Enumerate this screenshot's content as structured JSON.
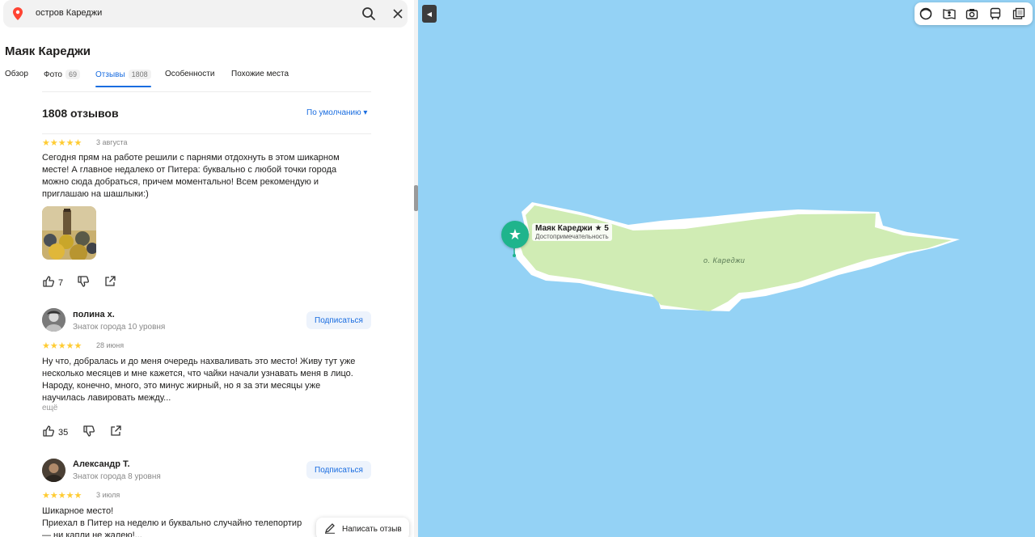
{
  "search": {
    "query": "остров Кареджи"
  },
  "place": {
    "title": "Маяк Кареджи"
  },
  "tabs": [
    {
      "label": "Обзор"
    },
    {
      "label": "Фото",
      "count": "69"
    },
    {
      "label": "Отзывы",
      "count": "1808"
    },
    {
      "label": "Особенности"
    },
    {
      "label": "Похожие места"
    }
  ],
  "reviews_header": {
    "title": "1808 отзывов",
    "sort_label": "По умолчанию ▾"
  },
  "reviews": [
    {
      "stars": "★★★★★",
      "rating": 5,
      "date": "3 августа",
      "text": [
        "Сегодня прям на работе решили с парнями отдохнуть в этом шикарном",
        "месте! А главное недалеко от Питера: буквально с любой точки города",
        "можно сюда добраться, причем моментально! Всем рекомендую и",
        "приглашаю на шашлыки:)"
      ],
      "likes": "7"
    },
    {
      "author": "полина х.",
      "level": "Знаток города 10 уровня",
      "subscribe": "Подписаться",
      "stars": "★★★★★",
      "rating": 5,
      "date": "28 июня",
      "text": [
        "Ну что, добралась и до меня очередь нахваливать это место! Живу тут уже",
        "несколько месяцев и мне кажется, что чайки начали узнавать меня в лицо.",
        "Народу, конечно, много, это минус жирный, но я за эти месяцы уже",
        "научилась лавировать между..."
      ],
      "more": "ещё",
      "likes": "35"
    },
    {
      "author": "Александр Т.",
      "level": "Знаток города 8 уровня",
      "subscribe": "Подписаться",
      "stars": "★★★★★",
      "rating": 5,
      "date": "3 июля",
      "text": [
        "Шикарное место!",
        "Приехал в Питер на неделю и буквально случайно телепортир",
        "— ни капли не жалею!..."
      ]
    }
  ],
  "write_review": "Написать отзыв",
  "map": {
    "marker": {
      "name": "Маяк Кареджи ★ 5",
      "category": "Достопримечательность"
    },
    "island_label": "о. Кареджи",
    "colors": {
      "water": "#94d2f5",
      "land": "#d0ecb4",
      "marker": "#1fb48c"
    }
  },
  "map_controls": [
    "traffic-icon",
    "panorama-icon",
    "photo-icon",
    "transit-icon",
    "layers-icon"
  ]
}
